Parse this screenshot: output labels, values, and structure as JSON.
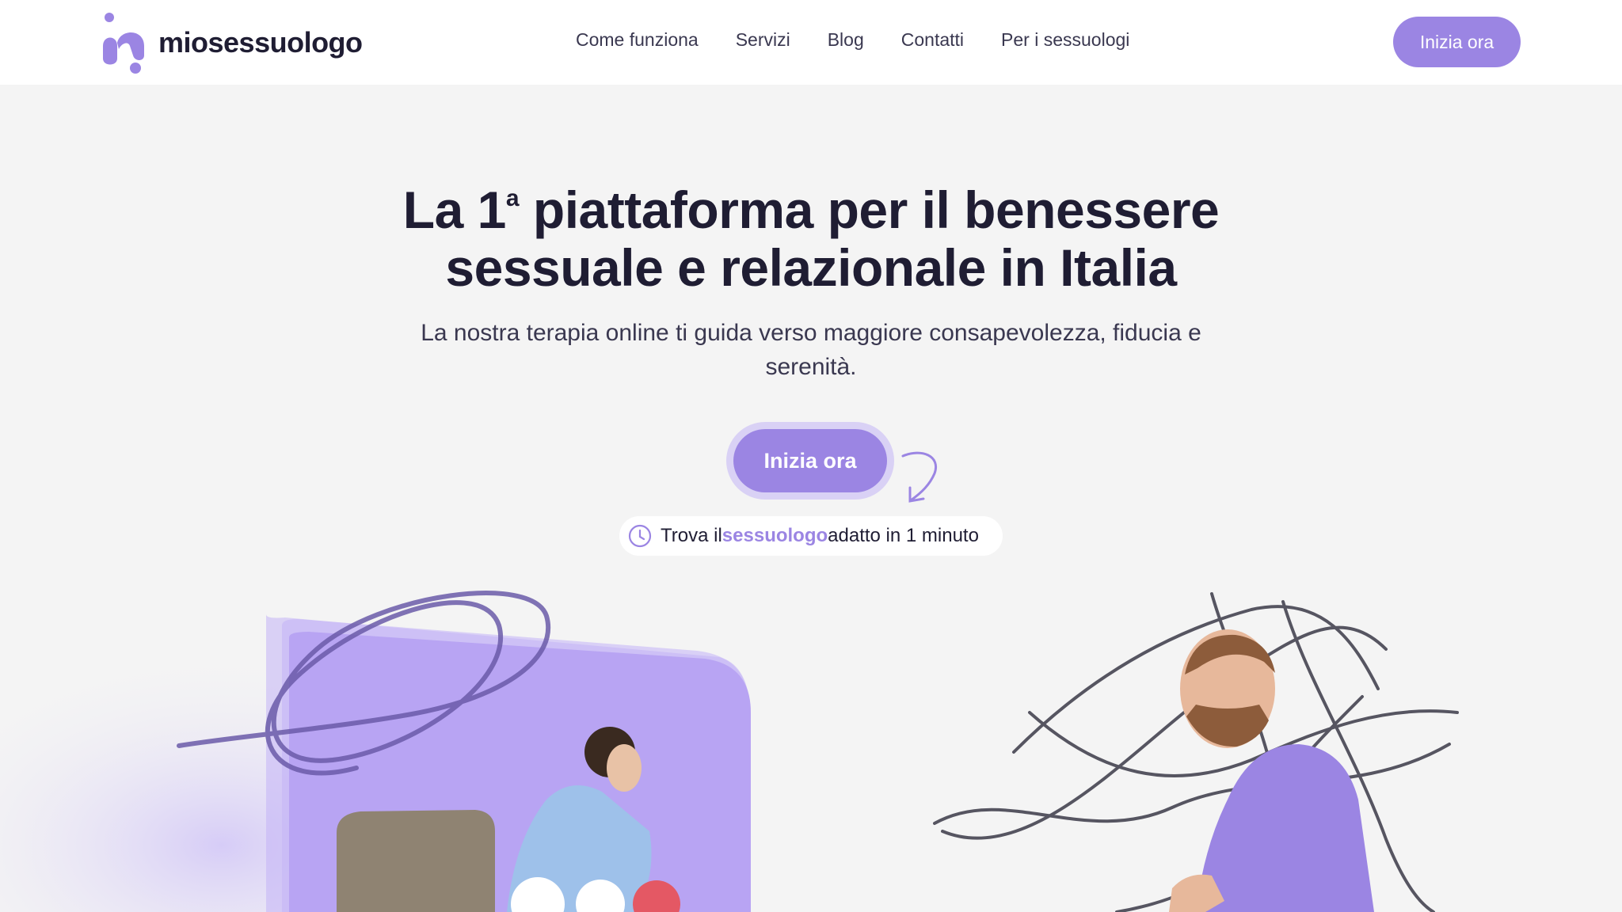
{
  "brand": {
    "name": "miosessuologo"
  },
  "nav": {
    "items": [
      {
        "label": "Come funziona"
      },
      {
        "label": "Servizi"
      },
      {
        "label": "Blog"
      },
      {
        "label": "Contatti"
      },
      {
        "label": "Per i sessuologi"
      }
    ],
    "cta_label": "Inizia ora"
  },
  "hero": {
    "title_part1": "La 1",
    "title_sup": "a",
    "title_part2": " piattaforma per il benessere sessuale e relazionale in Italia",
    "subtitle": "La nostra terapia online ti guida verso maggiore consapevolezza, fiducia e serenità.",
    "cta_label": "Inizia ora",
    "hint": {
      "prefix": "Trova il ",
      "highlight": "sessuologo",
      "suffix": " adatto in 1 minuto",
      "icon": "clock-icon"
    }
  },
  "colors": {
    "accent": "#9b85e3",
    "accent_light": "#d9d1f5",
    "text": "#1f1d33",
    "background": "#f4f4f4"
  }
}
